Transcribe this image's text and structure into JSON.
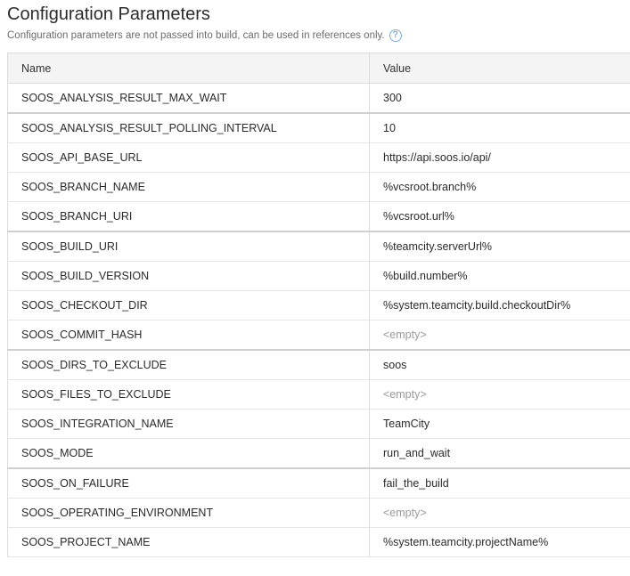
{
  "header": {
    "title": "Configuration Parameters",
    "subtitle": "Configuration parameters are not passed into build, can be used in references only.",
    "help_glyph": "?"
  },
  "table": {
    "columns": [
      "Name",
      "Value"
    ],
    "rows": [
      {
        "name": "SOOS_ANALYSIS_RESULT_MAX_WAIT",
        "value": "300",
        "empty": false,
        "group_end": true
      },
      {
        "name": "SOOS_ANALYSIS_RESULT_POLLING_INTERVAL",
        "value": "10",
        "empty": false,
        "group_end": false
      },
      {
        "name": "SOOS_API_BASE_URL",
        "value": "https://api.soos.io/api/",
        "empty": false,
        "group_end": false
      },
      {
        "name": "SOOS_BRANCH_NAME",
        "value": "%vcsroot.branch%",
        "empty": false,
        "group_end": false
      },
      {
        "name": "SOOS_BRANCH_URI",
        "value": "%vcsroot.url%",
        "empty": false,
        "group_end": true
      },
      {
        "name": "SOOS_BUILD_URI",
        "value": "%teamcity.serverUrl%",
        "empty": false,
        "group_end": false
      },
      {
        "name": "SOOS_BUILD_VERSION",
        "value": "%build.number%",
        "empty": false,
        "group_end": false
      },
      {
        "name": "SOOS_CHECKOUT_DIR",
        "value": "%system.teamcity.build.checkoutDir%",
        "empty": false,
        "group_end": false
      },
      {
        "name": "SOOS_COMMIT_HASH",
        "value": "<empty>",
        "empty": true,
        "group_end": true
      },
      {
        "name": "SOOS_DIRS_TO_EXCLUDE",
        "value": "soos",
        "empty": false,
        "group_end": false
      },
      {
        "name": "SOOS_FILES_TO_EXCLUDE",
        "value": "<empty>",
        "empty": true,
        "group_end": false
      },
      {
        "name": "SOOS_INTEGRATION_NAME",
        "value": "TeamCity",
        "empty": false,
        "group_end": false
      },
      {
        "name": "SOOS_MODE",
        "value": "run_and_wait",
        "empty": false,
        "group_end": true
      },
      {
        "name": "SOOS_ON_FAILURE",
        "value": "fail_the_build",
        "empty": false,
        "group_end": false
      },
      {
        "name": "SOOS_OPERATING_ENVIRONMENT",
        "value": "<empty>",
        "empty": true,
        "group_end": false
      },
      {
        "name": "SOOS_PROJECT_NAME",
        "value": "%system.teamcity.projectName%",
        "empty": false,
        "group_end": false
      }
    ]
  },
  "colors": {
    "header_bg": "#f4f4f4",
    "help_icon": "#4a8fd4",
    "empty_value": "#9a9a9a"
  }
}
